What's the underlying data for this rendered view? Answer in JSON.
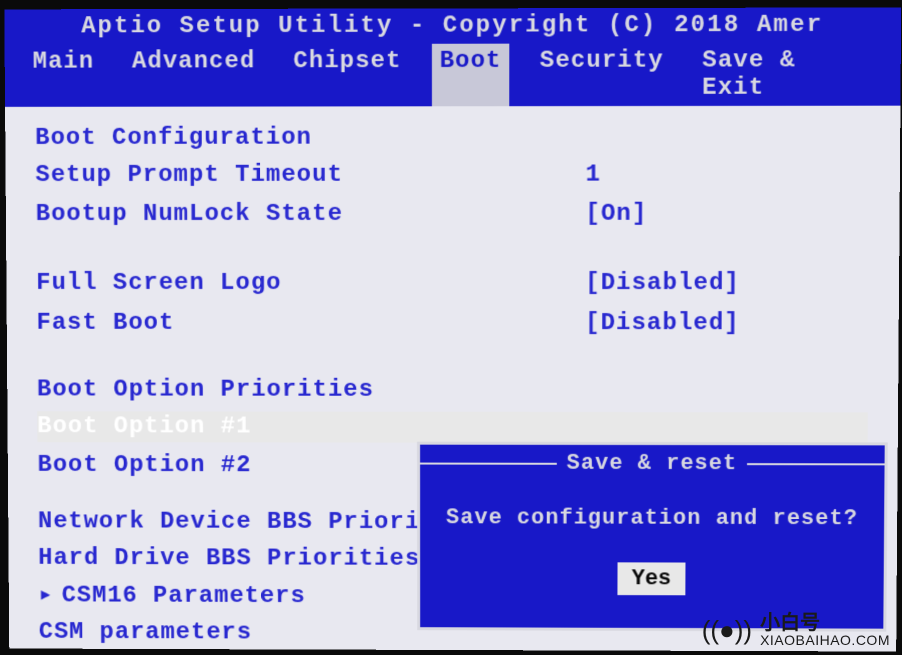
{
  "title": "Aptio Setup Utility - Copyright (C) 2018 Amer",
  "menu": {
    "items": [
      "Main",
      "Advanced",
      "Chipset",
      "Boot",
      "Security",
      "Save & Exit"
    ],
    "active_index": 3
  },
  "content": {
    "section1_header": "Boot Configuration",
    "rows": [
      {
        "label": "Setup Prompt Timeout",
        "value": "1"
      },
      {
        "label": "Bootup NumLock State",
        "value": "[On]"
      }
    ],
    "rows2": [
      {
        "label": "Full Screen Logo",
        "value": "[Disabled]"
      },
      {
        "label": "Fast Boot",
        "value": "[Disabled]"
      }
    ],
    "section2_header": "Boot Option Priorities",
    "boot_options": [
      {
        "label": "Boot Option #1",
        "selected": true
      },
      {
        "label": "Boot Option #2",
        "selected": false
      }
    ],
    "submenus": [
      {
        "label": "Network Device BBS Priorities",
        "arrow": false
      },
      {
        "label": "Hard Drive BBS Priorities",
        "arrow": false
      },
      {
        "label": "CSM16 Parameters",
        "arrow": true
      },
      {
        "label": "CSM parameters",
        "arrow": false
      }
    ]
  },
  "dialog": {
    "title": "Save & reset",
    "message": "Save configuration and reset?",
    "yes": "Yes"
  },
  "watermark": {
    "cn": "小白号",
    "url": "XIAOBAIHAO.COM"
  }
}
